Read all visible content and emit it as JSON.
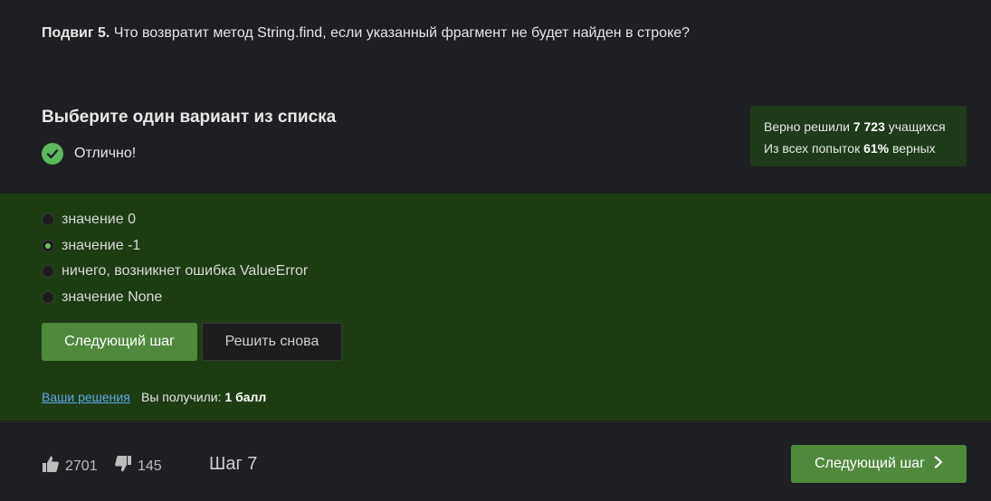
{
  "question": {
    "label": "Подвиг 5.",
    "text": "Что возвратит метод String.find, если указанный фрагмент не будет найден в строке?"
  },
  "section_title": "Выберите один вариант из списка",
  "status_text": "Отлично!",
  "stats": {
    "line1_prefix": "Верно решили",
    "solved_count": "7 723",
    "line1_suffix": "учащихся",
    "line2_prefix": "Из всех попыток",
    "percent": "61%",
    "line2_suffix": "верных"
  },
  "options": [
    {
      "label": "значение 0",
      "checked": false
    },
    {
      "label": "значение -1",
      "checked": true
    },
    {
      "label": "ничего, возникнет ошибка ValueError",
      "checked": false
    },
    {
      "label": "значение None",
      "checked": false
    }
  ],
  "buttons": {
    "next": "Следующий шаг",
    "retry": "Решить снова"
  },
  "solutions_link": "Ваши решения",
  "score": {
    "prefix": "Вы получили:",
    "value": "1 балл"
  },
  "footer": {
    "likes": "2701",
    "dislikes": "145",
    "step": "Шаг 7",
    "next": "Следующий шаг"
  },
  "colors": {
    "accent_green": "#4f8a3c",
    "answer_bg": "#1e3c14",
    "link_blue": "#5aa7e6"
  }
}
